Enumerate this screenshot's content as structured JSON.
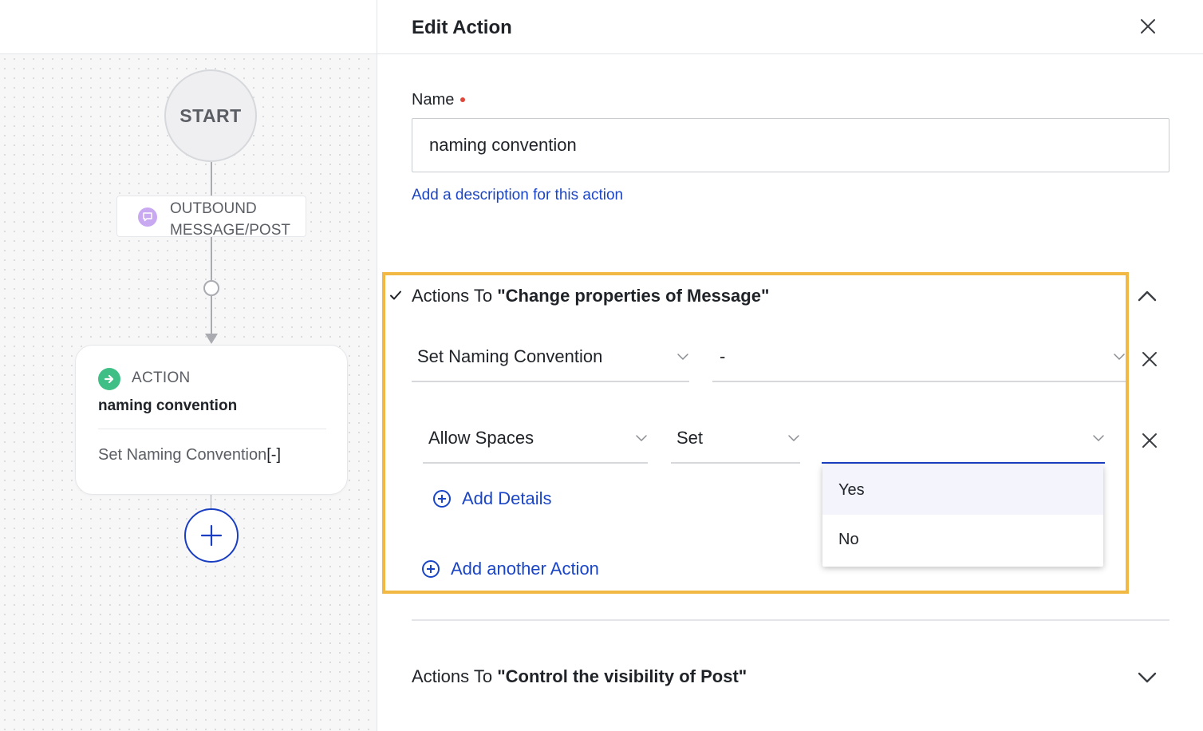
{
  "canvas": {
    "start_label": "START",
    "trigger": {
      "label": "OUTBOUND MESSAGE/POST",
      "icon": "message-icon",
      "icon_color": "#c8a8f1"
    },
    "action_card": {
      "type_label": "ACTION",
      "name": "naming convention",
      "summary_prefix": "Set Naming Convention",
      "summary_value": "[-]",
      "icon": "arrow-right-icon",
      "icon_color": "#3fbf86"
    },
    "add_node_icon": "plus-icon"
  },
  "panel": {
    "title": "Edit Action",
    "name_label": "Name",
    "name_value": "naming convention",
    "description_link": "Add a description for this action",
    "section1": {
      "prefix": "Actions To ",
      "target": "\"Change properties of Message\"",
      "rows": [
        {
          "field": "Set Naming Convention",
          "value": "-"
        },
        {
          "field": "Allow Spaces",
          "operator": "Set",
          "value": ""
        }
      ],
      "add_details": "Add Details",
      "add_another": "Add another Action",
      "dropdown_options": [
        "Yes",
        "No"
      ]
    },
    "section2": {
      "prefix": "Actions To ",
      "target": "\"Control the visibility of Post\""
    }
  },
  "colors": {
    "accent": "#1a45c7",
    "highlight_border": "#f1b844",
    "required": "#e0453a"
  }
}
